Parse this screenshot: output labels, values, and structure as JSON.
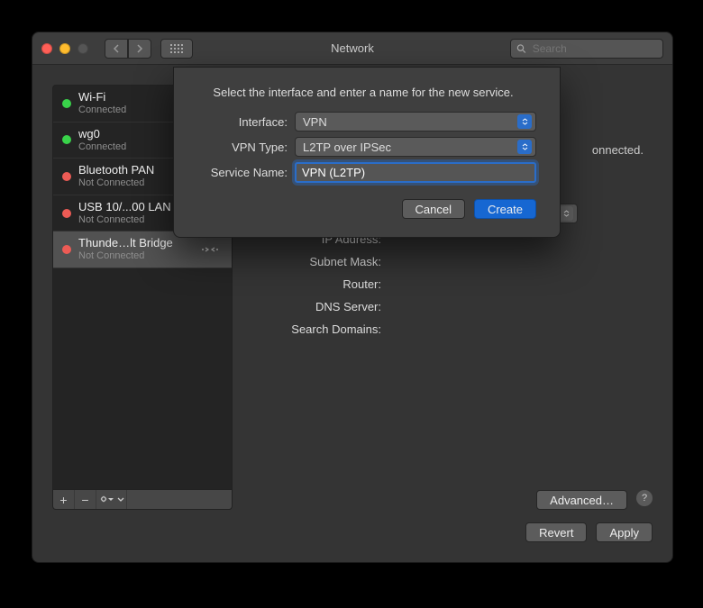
{
  "titlebar": {
    "title": "Network",
    "search_placeholder": "Search"
  },
  "sidebar": {
    "items": [
      {
        "name": "Wi-Fi",
        "status": "Connected",
        "dot": "sgrn"
      },
      {
        "name": "wg0",
        "status": "Connected",
        "dot": "sgrn"
      },
      {
        "name": "Bluetooth PAN",
        "status": "Not Connected",
        "dot": "sred"
      },
      {
        "name": "USB 10/...00 LAN",
        "status": "Not Connected",
        "dot": "sred"
      },
      {
        "name": "Thunde…lt Bridge",
        "status": "Not Connected",
        "dot": "sred"
      }
    ]
  },
  "details": {
    "labels": {
      "ip": "IP Address:",
      "subnet": "Subnet Mask:",
      "router": "Router:",
      "dns": "DNS Server:",
      "search": "Search Domains:"
    },
    "connected_tail": "onnected.",
    "advanced": "Advanced…"
  },
  "buttons": {
    "revert": "Revert",
    "apply": "Apply",
    "cancel": "Cancel",
    "create": "Create"
  },
  "modal": {
    "prompt": "Select the interface and enter a name for the new service.",
    "labels": {
      "interface": "Interface:",
      "vpntype": "VPN Type:",
      "servicename": "Service Name:"
    },
    "interface_value": "VPN",
    "vpntype_value": "L2TP over IPSec",
    "servicename_value": "VPN (L2TP)"
  },
  "help": "?"
}
